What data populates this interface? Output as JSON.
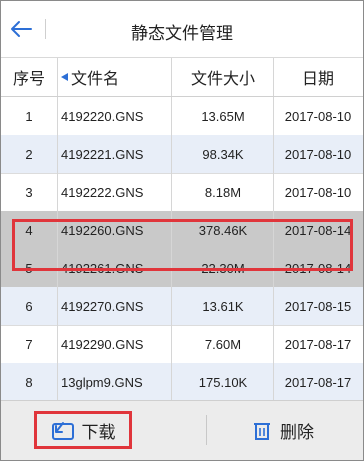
{
  "header": {
    "title": "静态文件管理"
  },
  "columns": {
    "index": "序号",
    "name": "文件名",
    "size": "文件大小",
    "date": "日期"
  },
  "rows": [
    {
      "index": "1",
      "name": "4192220.GNS",
      "size": "13.65M",
      "date": "2017-08-10",
      "style": "normal"
    },
    {
      "index": "2",
      "name": "4192221.GNS",
      "size": "98.34K",
      "date": "2017-08-10",
      "style": "alt"
    },
    {
      "index": "3",
      "name": "4192222.GNS",
      "size": "8.18M",
      "date": "2017-08-10",
      "style": "normal"
    },
    {
      "index": "4",
      "name": "4192260.GNS",
      "size": "378.46K",
      "date": "2017-08-14",
      "style": "selected"
    },
    {
      "index": "5",
      "name": "4192261.GNS",
      "size": "22.30M",
      "date": "2017-08-14",
      "style": "selected"
    },
    {
      "index": "6",
      "name": "4192270.GNS",
      "size": "13.61K",
      "date": "2017-08-15",
      "style": "alt"
    },
    {
      "index": "7",
      "name": "4192290.GNS",
      "size": "7.60M",
      "date": "2017-08-17",
      "style": "normal"
    },
    {
      "index": "8",
      "name": "13glpm9.GNS",
      "size": "175.10K",
      "date": "2017-08-17",
      "style": "alt"
    }
  ],
  "toolbar": {
    "download_label": "下载",
    "delete_label": "删除"
  },
  "icons": {
    "back": "back-arrow-icon",
    "sort": "sort-arrow-icon",
    "download": "download-icon",
    "delete": "trash-icon"
  },
  "colors": {
    "accent": "#2d6fd6",
    "highlight": "#e0353b",
    "row_alt": "#e8eef8",
    "row_selected": "#c9c9c9"
  }
}
